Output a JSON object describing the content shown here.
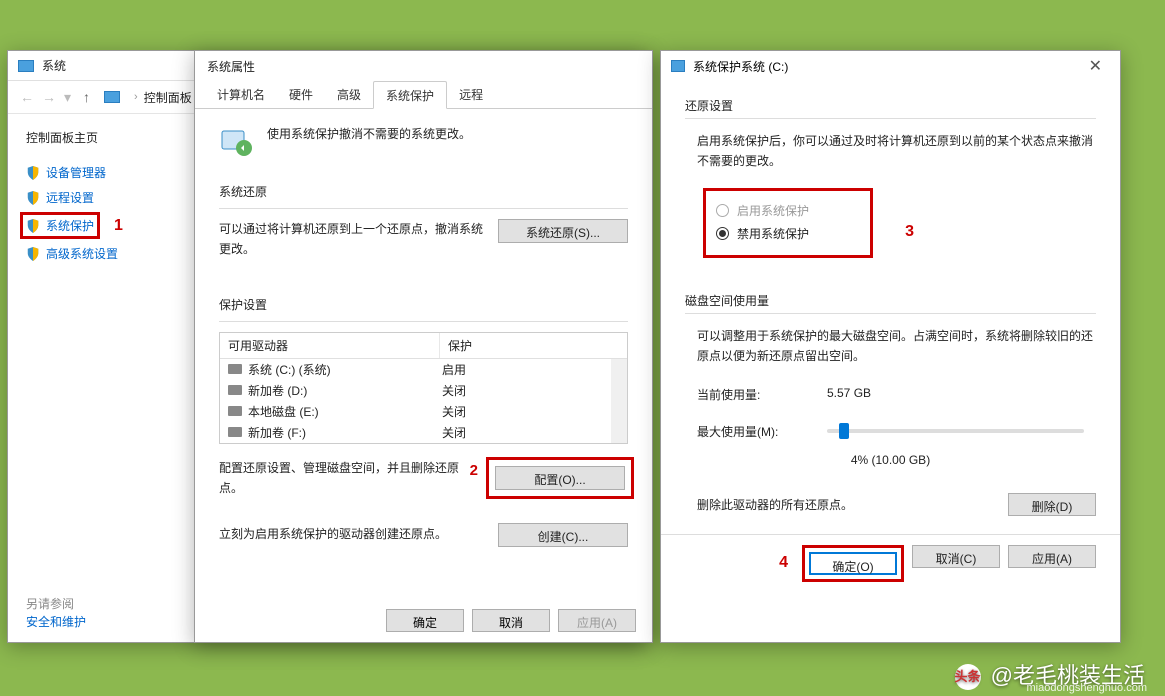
{
  "w1": {
    "title": "系统",
    "breadcrumb": "控制面板",
    "home_label": "控制面板主页",
    "side_items": [
      "设备管理器",
      "远程设置",
      "系统保护",
      "高级系统设置"
    ],
    "also_label": "另请参阅",
    "also_link": "安全和维护"
  },
  "w2": {
    "title": "系统属性",
    "tabs": [
      "计算机名",
      "硬件",
      "高级",
      "系统保护",
      "远程"
    ],
    "banner": "使用系统保护撤消不需要的系统更改。",
    "sect_restore": "系统还原",
    "restore_text": "可以通过将计算机还原到上一个还原点，撤消系统更改。",
    "restore_btn": "系统还原(S)...",
    "sect_protect": "保护设置",
    "hdr_drive": "可用驱动器",
    "hdr_status": "保护",
    "drives": [
      {
        "name": "系统 (C:) (系统)",
        "status": "启用"
      },
      {
        "name": "新加卷 (D:)",
        "status": "关闭"
      },
      {
        "name": "本地磁盘 (E:)",
        "status": "关闭"
      },
      {
        "name": "新加卷 (F:)",
        "status": "关闭"
      }
    ],
    "cfg_text": "配置还原设置、管理磁盘空间，并且删除还原点。",
    "cfg_btn": "配置(O)...",
    "create_text": "立刻为启用系统保护的驱动器创建还原点。",
    "create_btn": "创建(C)...",
    "ok": "确定",
    "cancel": "取消",
    "apply": "应用(A)"
  },
  "w3": {
    "title": "系统保护系统 (C:)",
    "sect_restore": "还原设置",
    "desc": "启用系统保护后，你可以通过及时将计算机还原到以前的某个状态点来撤消不需要的更改。",
    "opt_enable": "启用系统保护",
    "opt_disable": "禁用系统保护",
    "sect_usage": "磁盘空间使用量",
    "usage_desc": "可以调整用于系统保护的最大磁盘空间。占满空间时，系统将删除较旧的还原点以便为新还原点留出空间。",
    "cur_label": "当前使用量:",
    "cur_val": "5.57 GB",
    "max_label": "最大使用量(M):",
    "slider_val": "4% (10.00 GB)",
    "del_text": "删除此驱动器的所有还原点。",
    "del_btn": "删除(D)",
    "ok": "确定(O)",
    "cancel": "取消(C)",
    "apply": "应用(A)"
  },
  "callouts": {
    "c1": "1",
    "c2": "2",
    "c3": "3",
    "c4": "4"
  },
  "watermark": {
    "logo": "头条",
    "text": "@老毛桃装生活",
    "url": "miaodongshenghuo.com"
  }
}
